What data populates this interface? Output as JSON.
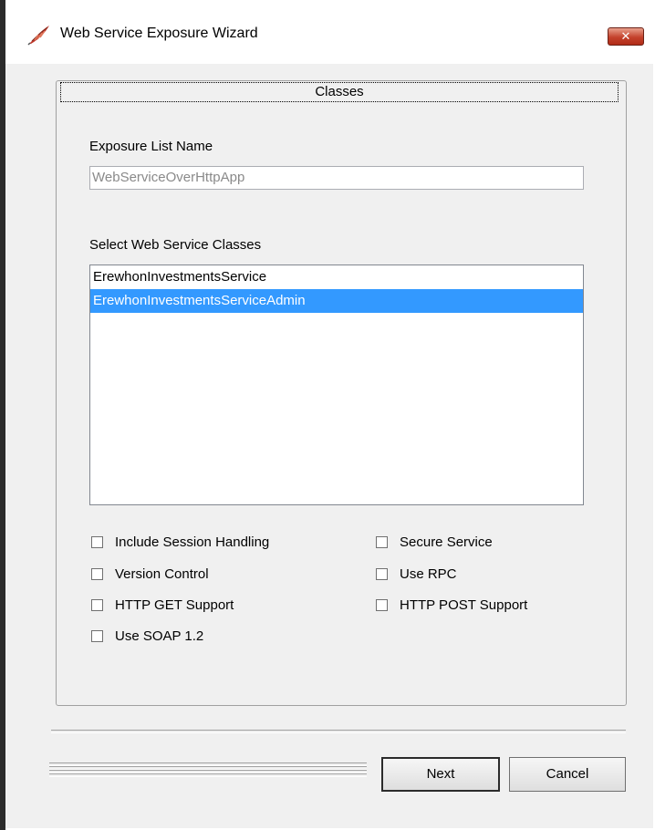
{
  "window": {
    "title": "Web Service Exposure Wizard",
    "close_glyph": "✕"
  },
  "tab": {
    "label": "Classes"
  },
  "exposure": {
    "label": "Exposure List Name",
    "value": "WebServiceOverHttpApp"
  },
  "classes": {
    "label": "Select Web Service Classes",
    "items": [
      {
        "label": "ErewhonInvestmentsService",
        "selected": false
      },
      {
        "label": "ErewhonInvestmentsServiceAdmin",
        "selected": true
      }
    ]
  },
  "options": {
    "include_session": {
      "label": "Include Session Handling",
      "checked": false
    },
    "secure_service": {
      "label": "Secure Service",
      "checked": false
    },
    "version_control": {
      "label": "Version Control",
      "checked": false
    },
    "use_rpc": {
      "label": "Use RPC",
      "checked": false
    },
    "http_get": {
      "label": "HTTP GET Support",
      "checked": false
    },
    "http_post": {
      "label": "HTTP POST Support",
      "checked": false
    },
    "soap12": {
      "label": "Use SOAP 1.2",
      "checked": false
    }
  },
  "buttons": {
    "next": "Next",
    "cancel": "Cancel"
  },
  "colors": {
    "selection": "#3399ff",
    "dialog_bg": "#f0f0f0"
  }
}
